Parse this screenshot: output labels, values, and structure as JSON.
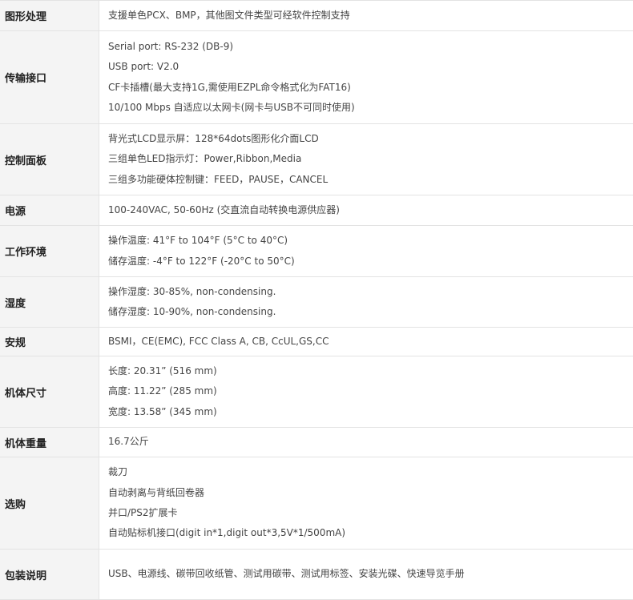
{
  "rows": [
    {
      "label": "图形处理",
      "lines": [
        "支援单色PCX、BMP，其他图文件类型可经软件控制支持"
      ]
    },
    {
      "label": "传输接口",
      "lines": [
        "Serial port: RS-232 (DB-9)",
        "USB port: V2.0",
        "CF卡插槽(最大支持1G,需使用EZPL命令格式化为FAT16)",
        "10/100 Mbps 自适应以太网卡(网卡与USB不可同时使用)"
      ]
    },
    {
      "label": "控制面板",
      "lines": [
        "背光式LCD显示屏：128*64dots图形化介面LCD",
        "三组单色LED指示灯：Power,Ribbon,Media",
        "三组多功能硬体控制键：FEED，PAUSE，CANCEL"
      ]
    },
    {
      "label": "电源",
      "lines": [
        "100-240VAC, 50-60Hz (交直流自动转换电源供应器)"
      ]
    },
    {
      "label": "工作环境",
      "lines": [
        "操作温度: 41°F to 104°F (5°C to 40°C)",
        "储存温度: -4°F to 122°F (-20°C to 50°C)"
      ]
    },
    {
      "label": "湿度",
      "lines": [
        "操作湿度: 30-85%, non-condensing.",
        "储存湿度: 10-90%, non-condensing."
      ]
    },
    {
      "label": "安规",
      "lines": [
        "BSMI，CE(EMC), FCC Class A, CB, CcUL,GS,CC"
      ]
    },
    {
      "label": "机体尺寸",
      "lines": [
        "长度: 20.31” (516 mm)",
        "高度: 11.22” (285 mm)",
        "宽度: 13.58” (345 mm)"
      ]
    },
    {
      "label": "机体重量",
      "lines": [
        "16.7公斤"
      ]
    },
    {
      "label": "选购",
      "lines": [
        "裁刀",
        "自动剥离与背纸回卷器",
        "并口/PS2扩展卡",
        "自动贴标机接口(digit in*1,digit out*3,5V*1/500mA)"
      ]
    },
    {
      "label": "包装说明",
      "lines": [
        "USB、电源线、碳带回收纸管、测试用碳带、测试用标签、安装光碟、快速导览手册"
      ]
    }
  ]
}
